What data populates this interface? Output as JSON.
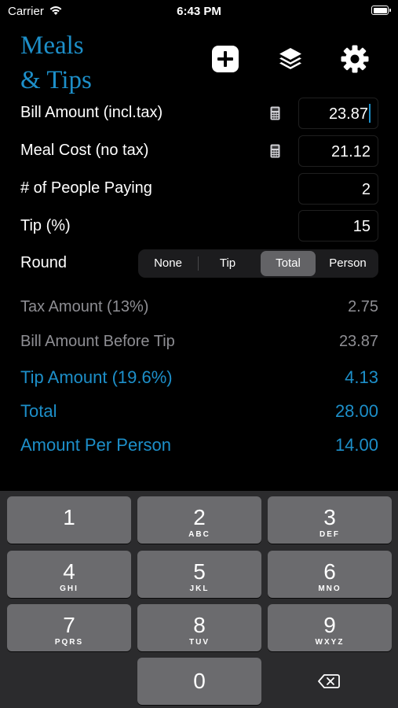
{
  "status_bar": {
    "carrier": "Carrier",
    "time": "6:43 PM"
  },
  "header": {
    "title_line1": "Meals",
    "title_line2": "& Tips",
    "icons": [
      "plus-square-icon",
      "layers-icon",
      "gear-icon"
    ]
  },
  "inputs": {
    "bill_amount": {
      "label": "Bill Amount (incl.tax)",
      "value": "23.87"
    },
    "meal_cost": {
      "label": "Meal Cost (no tax)",
      "value": "21.12"
    },
    "people": {
      "label": "# of People Paying",
      "value": "2"
    },
    "tip": {
      "label": "Tip (%)",
      "value": "15"
    }
  },
  "round": {
    "label": "Round",
    "options": [
      "None",
      "Tip",
      "Total",
      "Person"
    ],
    "selected": "Total"
  },
  "results": {
    "tax": {
      "label": "Tax Amount (13%)",
      "value": "2.75"
    },
    "before_tip": {
      "label": "Bill Amount Before Tip",
      "value": "23.87"
    },
    "tip_amount": {
      "label": "Tip Amount (19.6%)",
      "value": "4.13"
    },
    "total": {
      "label": "Total",
      "value": "28.00"
    },
    "per_person": {
      "label": "Amount Per Person",
      "value": "14.00"
    }
  },
  "keypad": {
    "keys": [
      {
        "num": "1",
        "letters": ""
      },
      {
        "num": "2",
        "letters": "ABC"
      },
      {
        "num": "3",
        "letters": "DEF"
      },
      {
        "num": "4",
        "letters": "GHI"
      },
      {
        "num": "5",
        "letters": "JKL"
      },
      {
        "num": "6",
        "letters": "MNO"
      },
      {
        "num": "7",
        "letters": "PQRS"
      },
      {
        "num": "8",
        "letters": "TUV"
      },
      {
        "num": "9",
        "letters": "WXYZ"
      },
      {
        "num": "0",
        "letters": ""
      }
    ]
  },
  "colors": {
    "accent": "#1d8fc9",
    "secondary_text": "#8e8e93",
    "key_bg": "#6b6b6e",
    "keypad_bg": "#2b2b2d"
  }
}
